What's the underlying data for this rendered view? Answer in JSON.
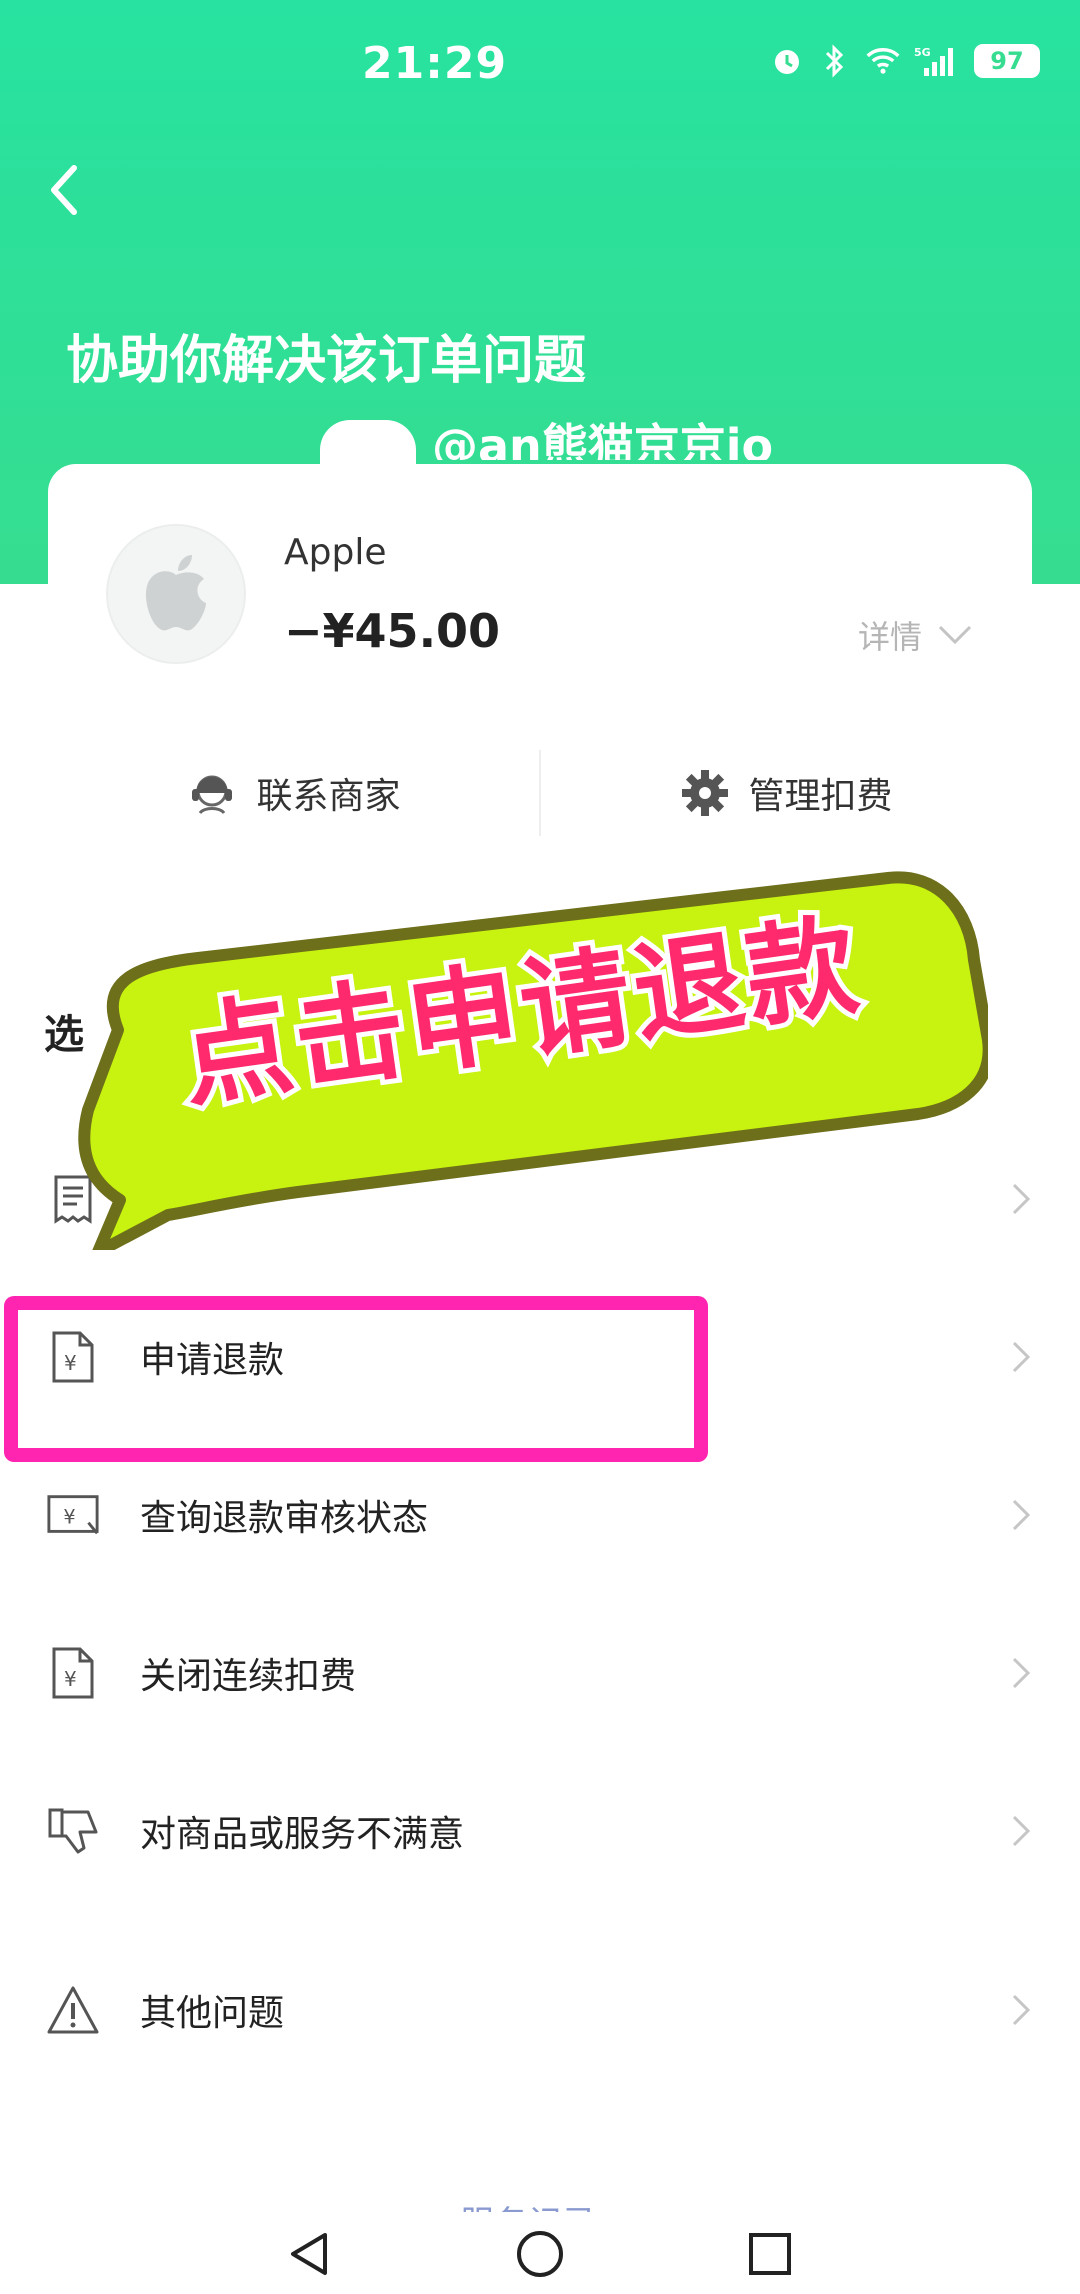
{
  "status_bar": {
    "time": "21:29",
    "battery": "97",
    "network": "5G"
  },
  "header": {
    "title": "协助你解决该订单问题",
    "watermark": "@an熊猫京京io"
  },
  "order_card": {
    "merchant": "Apple",
    "amount": "−¥45.00",
    "details_label": "详情",
    "actions": [
      {
        "label": "联系商家",
        "icon": "customer-service-icon"
      },
      {
        "label": "管理扣费",
        "icon": "gear-icon"
      }
    ]
  },
  "section": {
    "label": "选"
  },
  "callout": {
    "text": "点击申请退款"
  },
  "menu": [
    {
      "label": "",
      "icon": "receipt-icon"
    },
    {
      "label": "申请退款",
      "icon": "refund-document-icon"
    },
    {
      "label": "查询退款审核状态",
      "icon": "refund-status-icon"
    },
    {
      "label": "关闭连续扣费",
      "icon": "auto-debit-icon"
    },
    {
      "label": "对商品或服务不满意",
      "icon": "thumbs-down-icon"
    },
    {
      "label": "其他问题",
      "icon": "warning-icon"
    }
  ],
  "footer": {
    "service_log": "服务记录"
  },
  "colors": {
    "header_green": "#2fe09a",
    "callout_yellow": "#c8f20f",
    "callout_text": "#ff2a6d",
    "highlight_pink": "#ff25b0"
  }
}
